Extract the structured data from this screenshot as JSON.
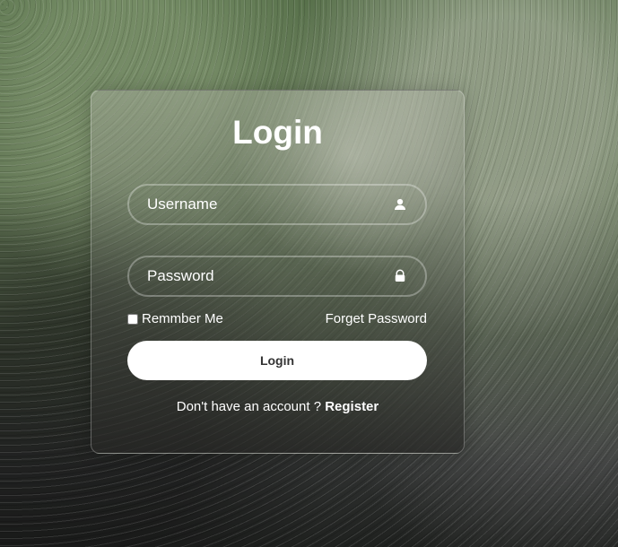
{
  "login_card": {
    "title": "Login",
    "username": {
      "value": "",
      "placeholder": "Username",
      "icon": "user-icon"
    },
    "password": {
      "value": "",
      "placeholder": "Password",
      "icon": "lock-icon"
    },
    "remember_label": "Remmber Me",
    "forgot_password_label": "Forget Password",
    "login_button_label": "Login",
    "register_prompt": "Don't have an account ? ",
    "register_link_label": "Register"
  },
  "colors": {
    "text": "#ffffff",
    "button_background": "#ffffff",
    "button_text": "#333333"
  }
}
